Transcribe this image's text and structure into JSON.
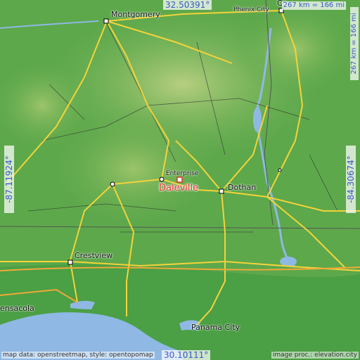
{
  "coordinates": {
    "top": "32.50391°",
    "bottom": "30.10111°",
    "left": "-87.11924°",
    "right": "-84.30674°"
  },
  "scale": {
    "top": "267 km = 166 mi",
    "right": "267 km = 166 mi"
  },
  "cities": {
    "montgomery": "Montgomery",
    "phenix_city": "Phenix City",
    "enterprise": "Enterprise",
    "dothan": "Dothan",
    "crestview": "Crestview",
    "pensacola": "ensacola",
    "panama_city": "Panama City",
    "co": "Co"
  },
  "main_city": "Daleville",
  "credits": {
    "left": "map data: openstreetmap, style: opentopomap",
    "right": "image proc.: elevation.city"
  },
  "colors": {
    "land": "#5aa64a",
    "highland": "#a7c872",
    "water": "#8fb8e4",
    "road": "#f4d33a",
    "marker": "#e8322e",
    "coord_text": "#3a59c8"
  }
}
